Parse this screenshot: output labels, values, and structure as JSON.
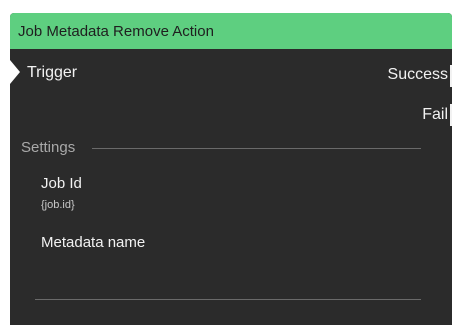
{
  "node": {
    "title": "Job Metadata Remove Action",
    "header_color": "#5ecf80",
    "input_port": {
      "label": "Trigger"
    },
    "output_ports": [
      {
        "label": "Success"
      },
      {
        "label": "Fail"
      }
    ],
    "settings": {
      "section_title": "Settings",
      "fields": [
        {
          "label": "Job Id",
          "value": "{job.id}"
        },
        {
          "label": "Metadata name",
          "value": ""
        }
      ]
    }
  }
}
